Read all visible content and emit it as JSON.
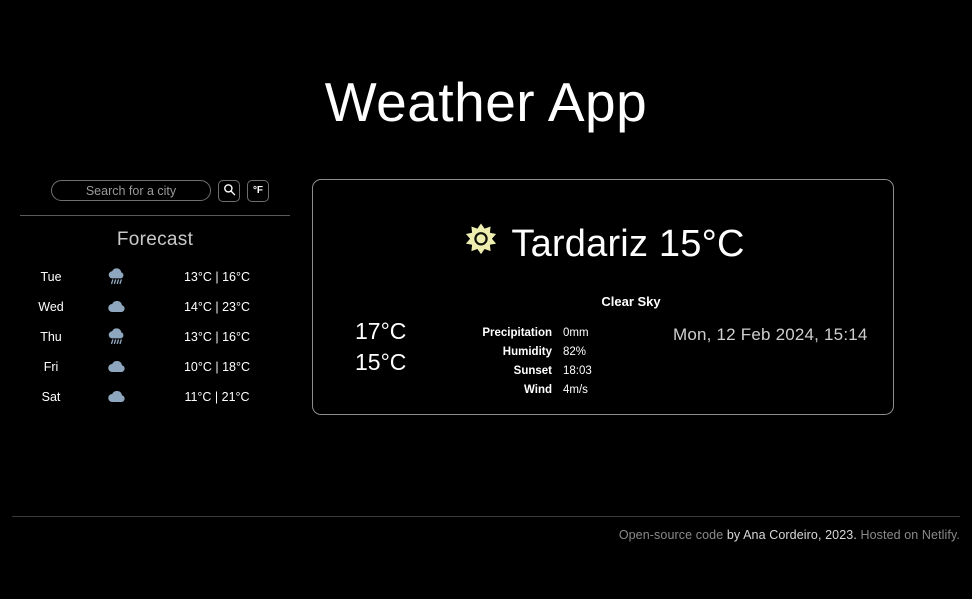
{
  "app": {
    "title": "Weather App",
    "accent_sun_color": "#eeeeb0",
    "cloud_color": "#8fa6bf",
    "card_border_color": "#8d8d8d"
  },
  "search": {
    "placeholder": "Search for a city",
    "value": "",
    "search_icon": "search-icon",
    "unit_toggle_label": "°F"
  },
  "forecast": {
    "heading": "Forecast",
    "days": [
      {
        "day": "Tue",
        "icon": "rain-cloud-icon",
        "temps": "13°C | 16°C"
      },
      {
        "day": "Wed",
        "icon": "cloud-icon",
        "temps": "14°C | 23°C"
      },
      {
        "day": "Thu",
        "icon": "rain-cloud-icon",
        "temps": "13°C | 16°C"
      },
      {
        "day": "Fri",
        "icon": "cloud-icon",
        "temps": "10°C | 18°C"
      },
      {
        "day": "Sat",
        "icon": "cloud-icon",
        "temps": "11°C | 21°C"
      }
    ]
  },
  "current": {
    "weather_icon": "sun-icon",
    "headline": "Tardariz 15°C",
    "condition": "Clear Sky",
    "temp_high": "17°C",
    "temp_low": "15°C",
    "datetime": "Mon, 12 Feb 2024, 15:14",
    "metrics": [
      {
        "label": "Precipitation",
        "value": "0mm"
      },
      {
        "label": "Humidity",
        "value": "82%"
      },
      {
        "label": "Sunset",
        "value": "18:03"
      },
      {
        "label": "Wind",
        "value": "4m/s"
      }
    ]
  },
  "footer": {
    "prefix": "Open-source code ",
    "link": "by Ana Cordeiro, 2023.",
    "suffix": " Hosted on Netlify."
  }
}
